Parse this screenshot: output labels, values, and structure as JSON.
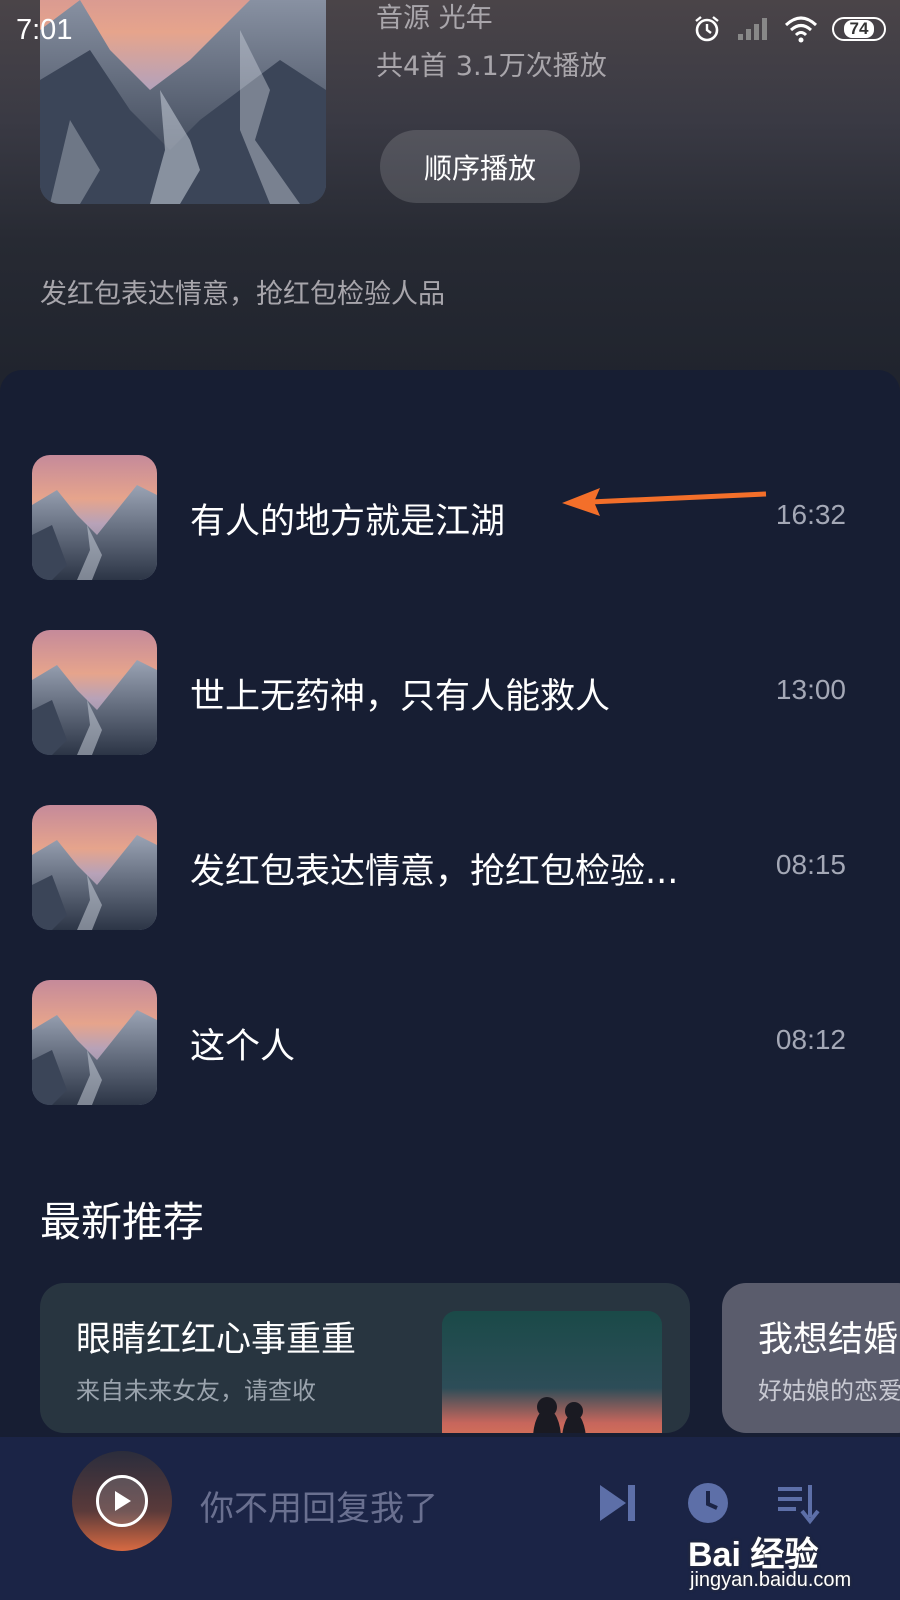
{
  "status_bar": {
    "time": "7:01",
    "battery": "74",
    "icons": [
      "alarm-icon",
      "signal-icon",
      "wifi-icon",
      "battery-icon"
    ]
  },
  "album": {
    "source_line": "音源  光年",
    "stats_line": "共4首  3.1万次播放",
    "play_order_label": "顺序播放",
    "description": "发红包表达情意，抢红包检验人品"
  },
  "tracks": [
    {
      "title": "有人的地方就是江湖",
      "duration": "16:32"
    },
    {
      "title": "世上无药神，只有人能救人",
      "duration": "13:00"
    },
    {
      "title": "发红包表达情意，抢红包检验...",
      "duration": "08:15"
    },
    {
      "title": "这个人",
      "duration": "08:12"
    }
  ],
  "recommend": {
    "section_title": "最新推荐",
    "cards": [
      {
        "title": "眼睛红红心事重重",
        "subtitle": "来自未来女友，请查收"
      },
      {
        "title": "我想结婚",
        "subtitle": "好姑娘的恋爱"
      }
    ]
  },
  "player": {
    "now_playing": "你不用回复我了",
    "controls": [
      "next-track-icon",
      "timer-icon",
      "playlist-icon"
    ]
  },
  "watermark": {
    "logo": "Bai 经验",
    "url": "jingyan.baidu.com"
  },
  "colors": {
    "background": "#171e33",
    "player_bar": "#1b2446",
    "annotation_arrow": "#f36f2a"
  }
}
